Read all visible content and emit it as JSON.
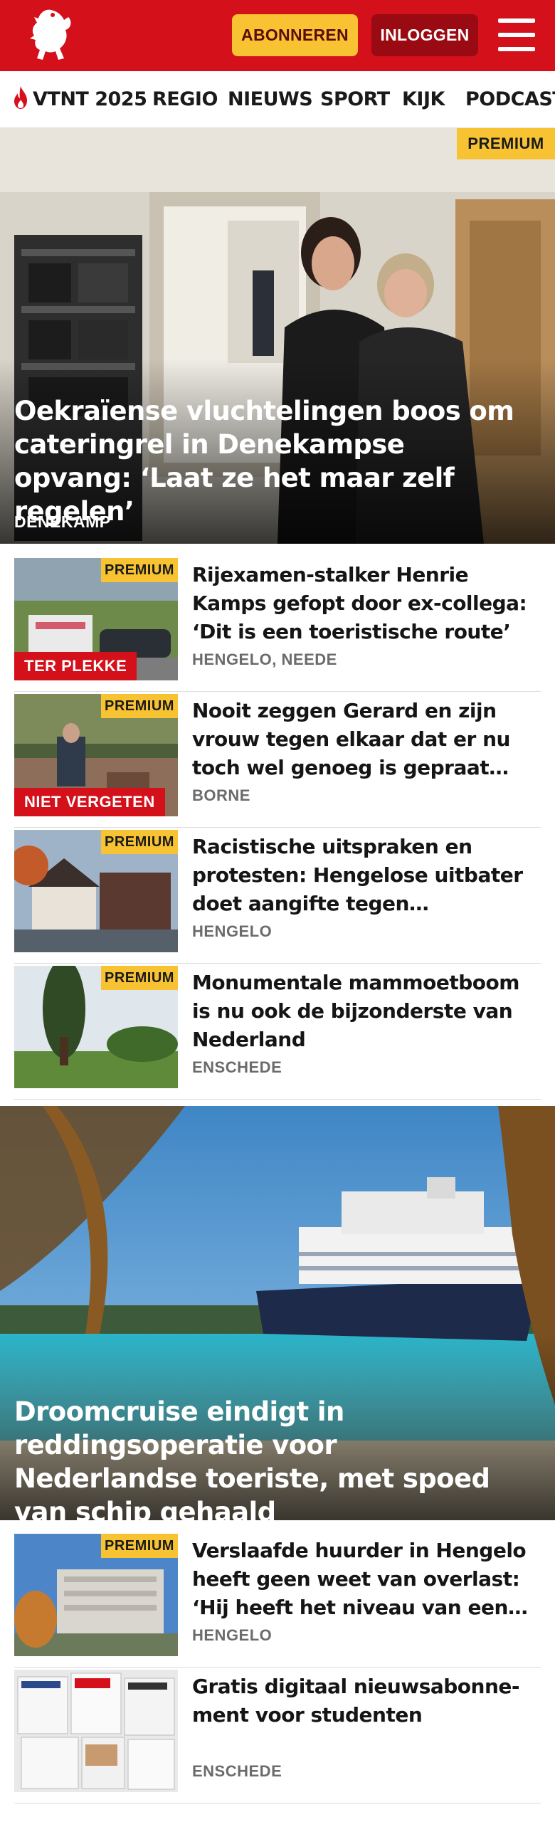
{
  "header": {
    "subscribe_label": "ABONNEREN",
    "login_label": "INLOGGEN",
    "brand_color": "#d4101b",
    "accent_color": "#f7c332"
  },
  "nav": {
    "items": [
      "VTNT 2025",
      "REGIO",
      "NIEUWS",
      "SPORT",
      "KIJK",
      "PODCAST"
    ],
    "first_item_icon": "flame-icon"
  },
  "hero_top": {
    "badge": "PREMIUM",
    "title": "Oekraïense vluchtelingen boos om cateringrel in Denekampse opvang: ‘Laat ze het maar zelf regelen’",
    "location": "DENEKAMP"
  },
  "articles": [
    {
      "badge": "PREMIUM",
      "label": "TER PLEKKE",
      "title": "Rijexamen-stalker Henrie Kamps gefopt door ex-collega: ‘Dit is een toeristische route’",
      "location": "HENGELO, NEEDE"
    },
    {
      "badge": "PREMIUM",
      "label": "NIET VERGETEN",
      "title": "Nooit zeggen Gerard en zijn vrouw tegen elkaar dat er nu toch wel genoeg is gepraat over het",
      "location": "BORNE"
    },
    {
      "badge": "PREMIUM",
      "label": "",
      "title": "Racistische uitspraken en protesten: Hengelose uitbater doet aangifte tegen buurtbewo­ners",
      "location": "HENGELO"
    },
    {
      "badge": "PREMIUM",
      "label": "",
      "title": "Monumentale mammoetboom is nu ook de bijzonderste van Nederland",
      "location": "ENSCHEDE"
    }
  ],
  "hero_mid": {
    "title": "Droomcruise eindigt in reddingsope­ratie voor Nederlandse toeriste, met spoed van schip gehaald"
  },
  "articles_2": [
    {
      "badge": "PREMIUM",
      "title": "Verslaafde huurder in Hengelo heeft geen weet van overlast: ‘Hij heeft het niveau van een kind van",
      "location": "HENGELO"
    },
    {
      "badge": "",
      "title": "Gratis digitaal nieuwsabonne­ment voor studenten",
      "location": "ENSCHEDE"
    }
  ]
}
